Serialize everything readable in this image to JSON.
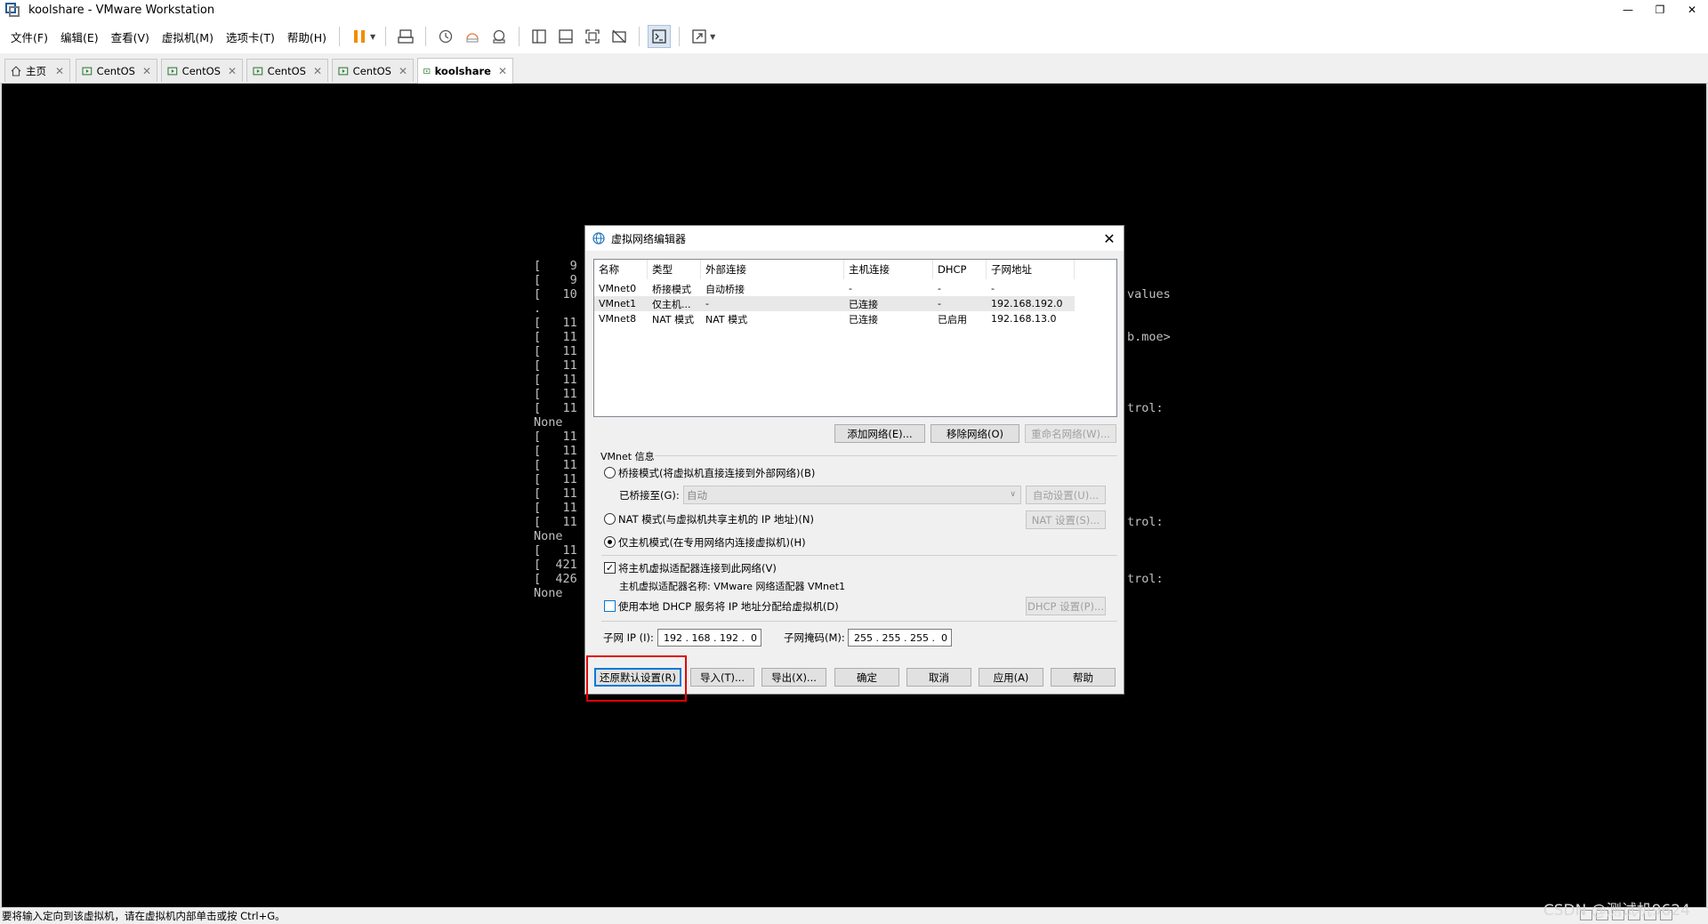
{
  "window": {
    "title": "koolshare - VMware Workstation"
  },
  "menu": [
    "文件(F)",
    "编辑(E)",
    "查看(V)",
    "虚拟机(M)",
    "选项卡(T)",
    "帮助(H)"
  ],
  "tabs": [
    {
      "label": "主页",
      "icon": "home-icon"
    },
    {
      "label": "CentOS",
      "icon": "vm-icon"
    },
    {
      "label": "CentOS",
      "icon": "vm-icon"
    },
    {
      "label": "CentOS",
      "icon": "vm-icon"
    },
    {
      "label": "CentOS",
      "icon": "vm-icon"
    },
    {
      "label": "koolshare",
      "icon": "vm-icon"
    }
  ],
  "console": {
    "left_lines": [
      "[    9",
      "[    9",
      "[   10",
      ".",
      "[   11",
      "[   11",
      "[   11",
      "[   11",
      "[   11",
      "[   11",
      "[   11",
      "None",
      "[   11",
      "[   11",
      "[   11",
      "[   11",
      "[   11",
      "[   11",
      "[   11",
      "None",
      "[   11",
      "[  421",
      "[  426",
      "None"
    ],
    "right_lines": [
      "values",
      "b.moe>",
      "trol:",
      "trol:",
      "trol:"
    ]
  },
  "dialog": {
    "title": "虚拟网络编辑器",
    "columns": [
      "名称",
      "类型",
      "外部连接",
      "主机连接",
      "DHCP",
      "子网地址"
    ],
    "rows": [
      [
        "VMnet0",
        "桥接模式",
        "自动桥接",
        "-",
        "-",
        "-"
      ],
      [
        "VMnet1",
        "仅主机...",
        "-",
        "已连接",
        "-",
        "192.168.192.0"
      ],
      [
        "VMnet8",
        "NAT 模式",
        "NAT 模式",
        "已连接",
        "已启用",
        "192.168.13.0"
      ]
    ],
    "list_buttons": {
      "add": "添加网络(E)...",
      "remove": "移除网络(O)",
      "rename": "重命名网络(W)..."
    },
    "vmnet_info_label": "VMnet 信息",
    "bridged_label": "桥接模式(将虚拟机直接连接到外部网络)(B)",
    "bridged_to_label": "已桥接至(G):",
    "bridged_to_value": "自动",
    "auto_settings": "自动设置(U)...",
    "nat_label": "NAT 模式(与虚拟机共享主机的 IP 地址)(N)",
    "nat_settings": "NAT 设置(S)...",
    "hostonly_label": "仅主机模式(在专用网络内连接虚拟机)(H)",
    "connect_adapter_label": "将主机虚拟适配器连接到此网络(V)",
    "adapter_name_label": "主机虚拟适配器名称: VMware 网络适配器 VMnet1",
    "dhcp_label": "使用本地 DHCP 服务将 IP 地址分配给虚拟机(D)",
    "dhcp_settings": "DHCP 设置(P)...",
    "subnet_ip_label": "子网 IP (I):",
    "subnet_ip_value": "192 . 168 . 192 .  0",
    "subnet_mask_label": "子网掩码(M):",
    "subnet_mask_value": "255 . 255 . 255 .  0",
    "buttons": {
      "restore": "还原默认设置(R)",
      "import": "导入(T)...",
      "export": "导出(X)...",
      "ok": "确定",
      "cancel": "取消",
      "apply": "应用(A)",
      "help": "帮助"
    }
  },
  "status": {
    "text": "要将输入定向到该虚拟机，请在虚拟机内部单击或按 Ctrl+G。",
    "watermark": "CSDN @测试机9624"
  },
  "colors": {
    "highlight": "#e00000",
    "pause": "#f28c00",
    "accent": "#0078d7"
  }
}
